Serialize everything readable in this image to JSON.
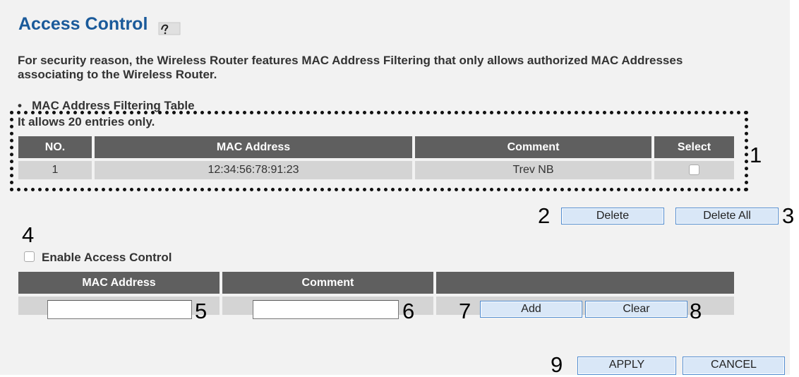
{
  "page": {
    "title": "Access Control",
    "help_icon": "help-icon",
    "description": "For security reason, the Wireless Router features MAC Address Filtering that only allows authorized MAC Addresses associating to the Wireless Router.",
    "table_heading": "MAC Address Filtering Table",
    "entries_note": "It allows 20 entries only."
  },
  "filter_table": {
    "headers": [
      "NO.",
      "MAC Address",
      "Comment",
      "Select"
    ],
    "rows": [
      {
        "no": "1",
        "mac": "12:34:56:78:91:23",
        "comment": "Trev NB",
        "selected": false
      }
    ]
  },
  "table_actions": {
    "delete_label": "Delete",
    "delete_all_label": "Delete All"
  },
  "enable": {
    "label": "Enable Access Control",
    "checked": false
  },
  "add_table": {
    "headers": [
      "MAC Address",
      "Comment",
      ""
    ],
    "mac_value": "",
    "comment_value": "",
    "add_label": "Add",
    "clear_label": "Clear"
  },
  "footer": {
    "apply_label": "APPLY",
    "cancel_label": "CANCEL"
  },
  "callouts": [
    "1",
    "2",
    "3",
    "4",
    "5",
    "6",
    "7",
    "8",
    "9"
  ]
}
